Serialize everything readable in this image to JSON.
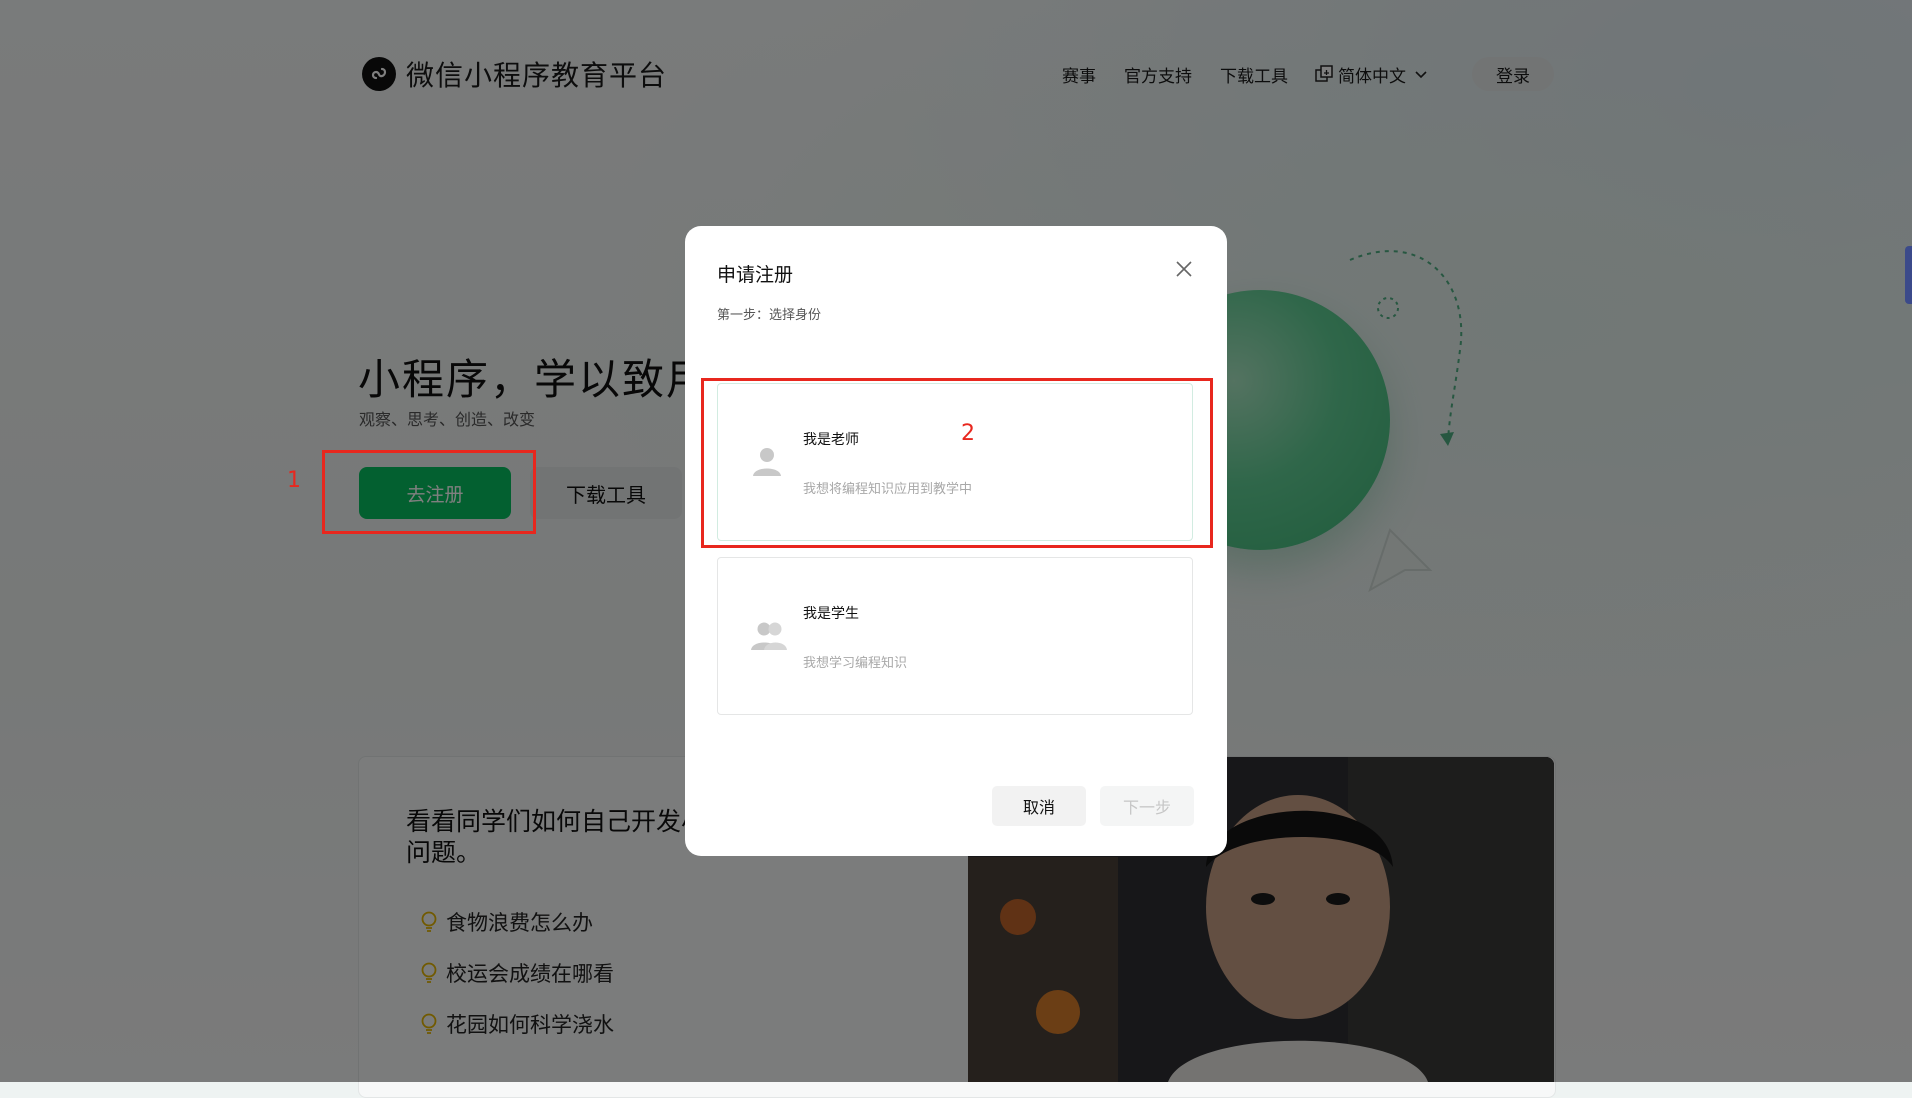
{
  "header": {
    "brand": "微信小程序教育平台",
    "nav": [
      "赛事",
      "官方支持",
      "下载工具"
    ],
    "language": "简体中文",
    "login_label": "登录"
  },
  "hero": {
    "title": "小程序，学以致用",
    "subtitle": "观察、思考、创造、改变",
    "register_label": "去注册",
    "download_label": "下载工具"
  },
  "story": {
    "title": "看看同学们如何自己开发小 问题。",
    "items": [
      "食物浪费怎么办",
      "校运会成绩在哪看",
      "花园如何科学浇水"
    ]
  },
  "modal": {
    "title": "申请注册",
    "step": "第一步：选择身份",
    "roles": [
      {
        "name": "我是老师",
        "desc": "我想将编程知识应用到教学中"
      },
      {
        "name": "我是学生",
        "desc": "我想学习编程知识"
      }
    ],
    "cancel_label": "取消",
    "next_label": "下一步"
  },
  "annotations": {
    "one": "1",
    "two": "2"
  },
  "colors": {
    "brand_green": "#07c160",
    "annotation_red": "#e8271e"
  }
}
